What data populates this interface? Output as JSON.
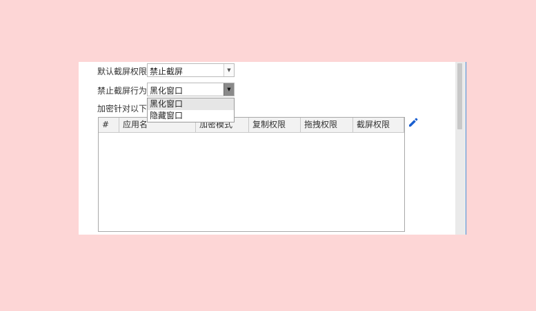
{
  "settings": {
    "default_label": "默认截屏权限",
    "default_value": "禁止截屏",
    "behavior_label": "禁止截屏行为",
    "behavior_value": "黑化窗口",
    "encrypt_label": "加密针对以下程序"
  },
  "dropdown": {
    "options": [
      "黑化窗口",
      "隐藏窗口"
    ],
    "selected_index": 0
  },
  "table": {
    "columns": [
      "#",
      "应用名",
      "加密模式",
      "复制权限",
      "拖拽权限",
      "截屏权限"
    ]
  },
  "colors": {
    "background": "#fdd6d6",
    "edit_icon": "#1a5fd0"
  },
  "icons": {
    "dropdown_arrow": "chevron-down-icon",
    "edit": "pencil-icon"
  }
}
